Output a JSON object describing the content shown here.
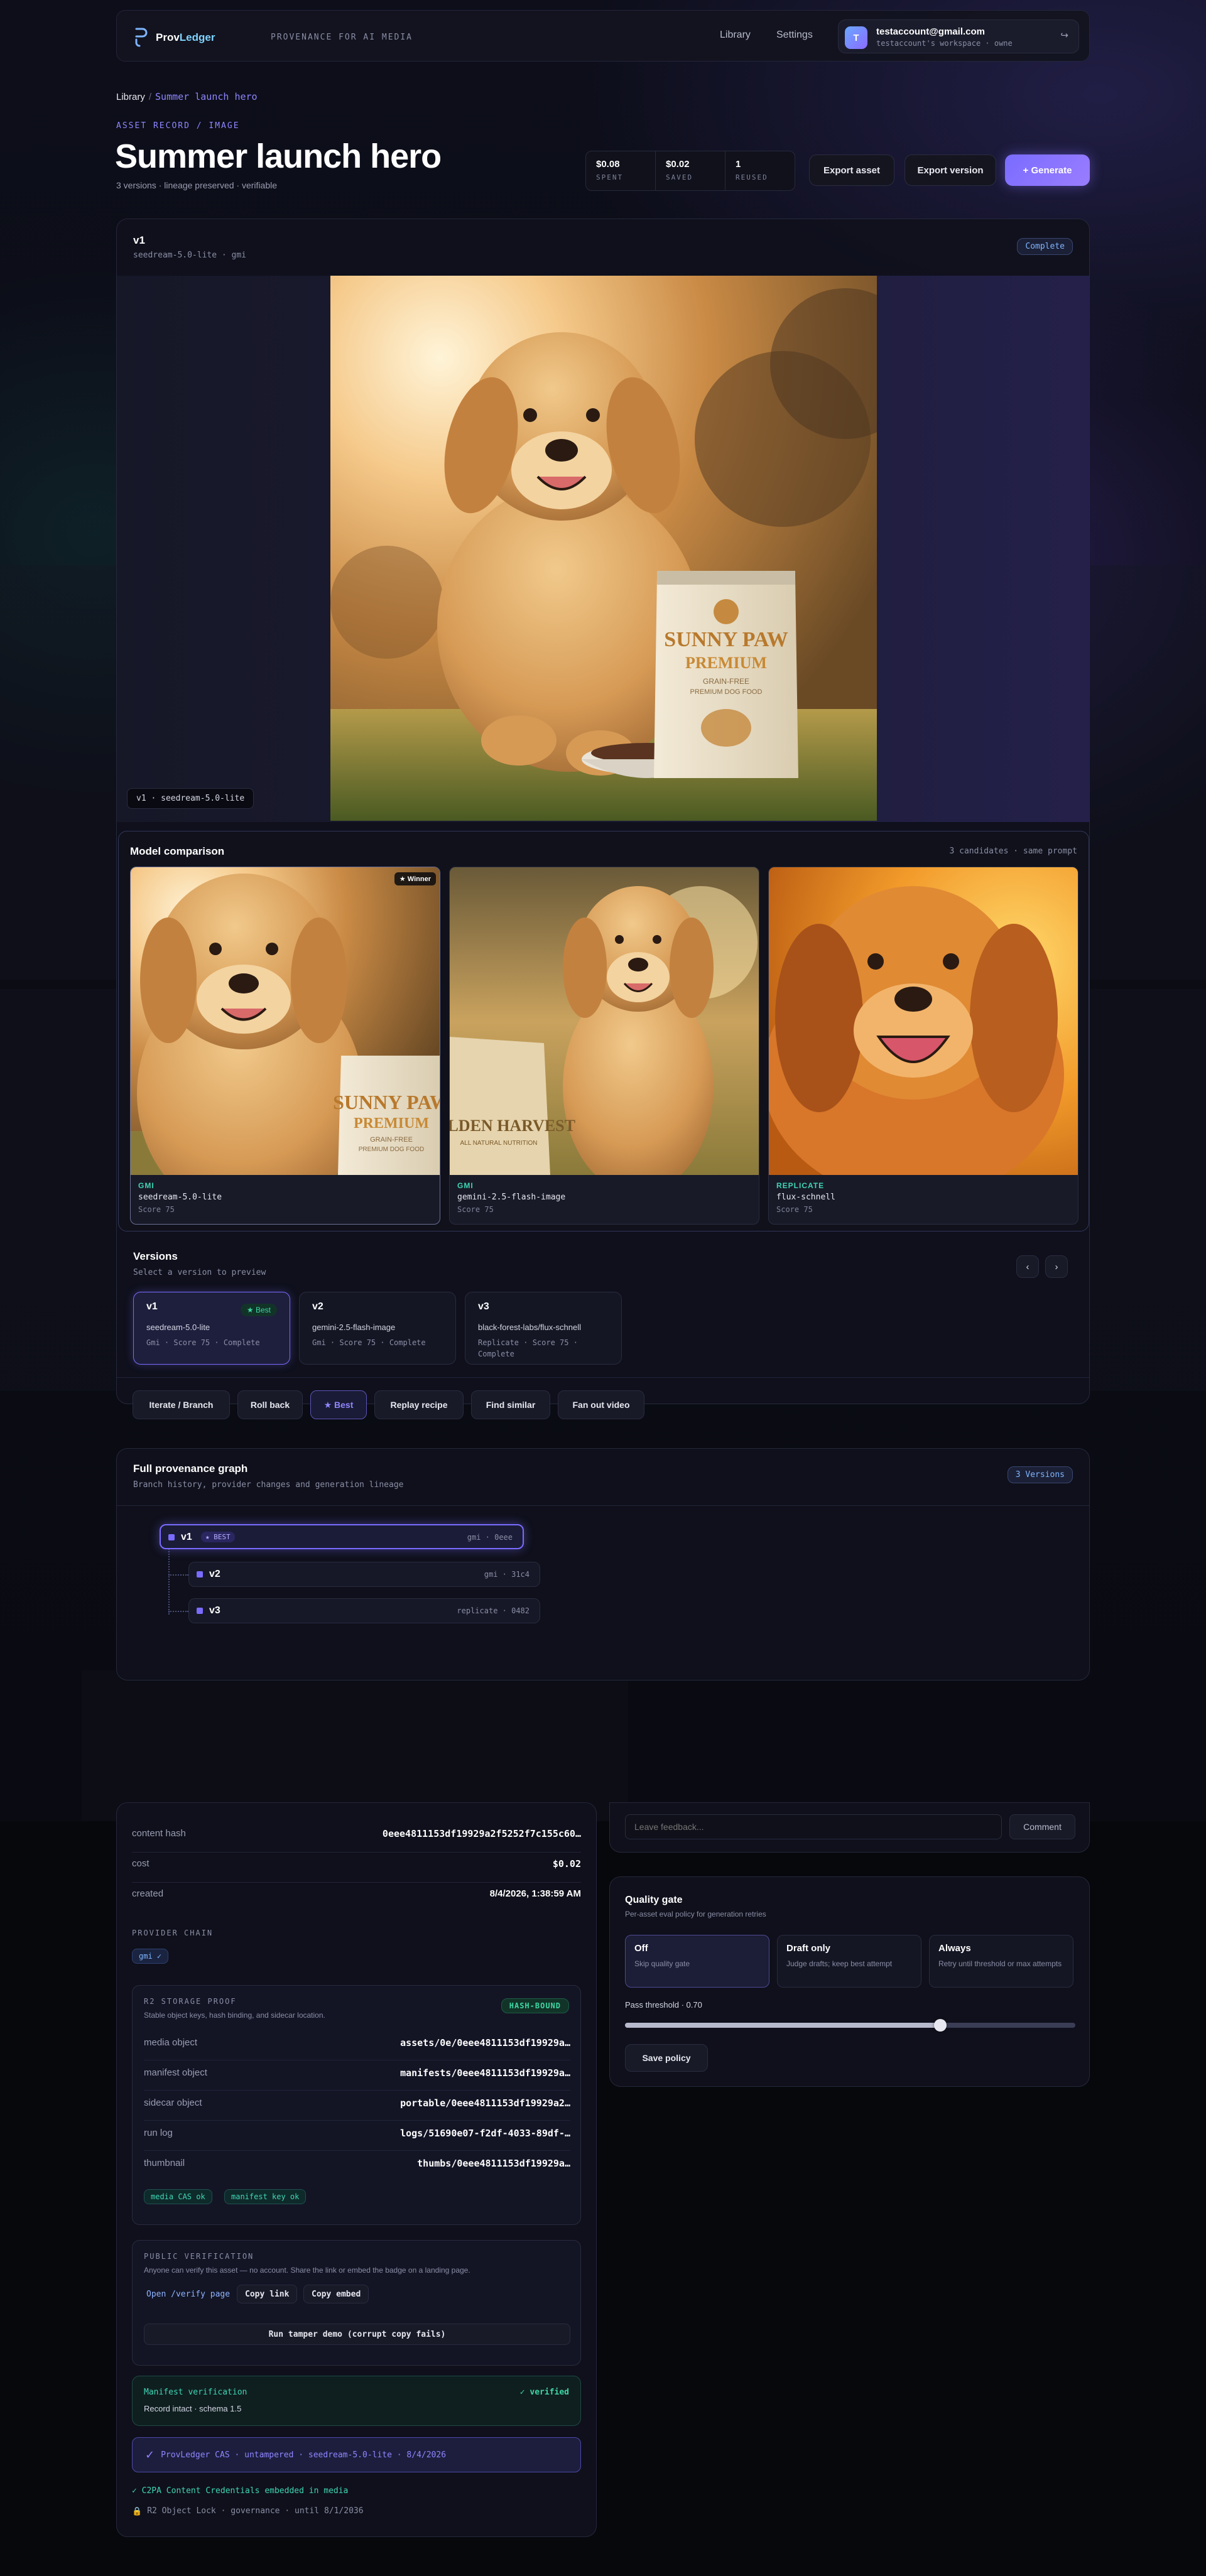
{
  "brand": {
    "name_part1": "Prov",
    "name_part2": "Ledger",
    "tagline": "PROVENANCE FOR AI MEDIA"
  },
  "nav": {
    "library": "Library",
    "settings": "Settings"
  },
  "account": {
    "initial": "T",
    "email": "testaccount@gmail.com",
    "workspace": "testaccount's workspace · owne",
    "logout_icon": "logout-icon"
  },
  "breadcrumb": {
    "root": "Library",
    "separator": "/",
    "current": "Summer launch hero"
  },
  "header": {
    "eyebrow": "ASSET RECORD / IMAGE",
    "title": "Summer launch hero",
    "subtitle": "3 versions · lineage preserved · verifiable"
  },
  "stats": [
    {
      "value": "$0.08",
      "label": "SPENT"
    },
    {
      "value": "$0.02",
      "label": "SAVED"
    },
    {
      "value": "1",
      "label": "REUSED"
    }
  ],
  "actions": {
    "export_asset": "Export asset",
    "export_version": "Export version",
    "generate": "+ Generate"
  },
  "current_version": {
    "name": "v1",
    "model": "seedream-5.0-lite · gmi",
    "status": "Complete",
    "caption": "v1 · seedream-5.0-lite"
  },
  "comparison": {
    "title": "Model comparison",
    "meta": "3 candidates · same prompt",
    "winner_label": "★ Winner",
    "candidates": [
      {
        "provider": "GMI",
        "model": "seedream-5.0-lite",
        "score": "Score 75",
        "bag_line1": "SUNNY PAW",
        "bag_line2": "PREMIUM",
        "bag_line3": "GRAIN-FREE",
        "bag_line4": "PREMIUM DOG FOOD"
      },
      {
        "provider": "GMI",
        "model": "gemini-2.5-flash-image",
        "score": "Score 75",
        "bag_line1": "GOLDEN HARVEST",
        "bag_line2": "ALL NATURAL NUTRITION"
      },
      {
        "provider": "REPLICATE",
        "model": "flux-schnell",
        "score": "Score 75"
      }
    ]
  },
  "hero_bag": {
    "line1": "SUNNY PAW",
    "line2": "PREMIUM",
    "line3": "GRAIN-FREE",
    "line4": "PREMIUM DOG FOOD"
  },
  "versions": {
    "title": "Versions",
    "subtitle": "Select a version to preview",
    "prev": "‹",
    "next": "›",
    "items": [
      {
        "name": "v1",
        "badge": "★ Best",
        "model": "seedream-5.0-lite",
        "meta": "Gmi · Score 75 · Complete"
      },
      {
        "name": "v2",
        "model": "gemini-2.5-flash-image",
        "meta": "Gmi · Score 75 · Complete"
      },
      {
        "name": "v3",
        "model": "black-forest-labs/flux-schnell",
        "meta": "Replicate · Score 75 · Complete"
      }
    ]
  },
  "version_actions": [
    "Iterate / Branch",
    "Roll back",
    "★ Best",
    "Replay recipe",
    "Find similar",
    "Fan out video"
  ],
  "provenance": {
    "title": "Full provenance graph",
    "subtitle": "Branch history, provider changes and generation lineage",
    "badge": "3 Versions",
    "nodes": [
      {
        "name": "v1",
        "best": "★ BEST",
        "meta": "gmi · 0eee"
      },
      {
        "name": "v2",
        "meta": "gmi · 31c4"
      },
      {
        "name": "v3",
        "meta": "replicate · 0482"
      }
    ]
  },
  "details": {
    "rows": [
      {
        "key": "content hash",
        "value": "0eee4811153df19929a2f5252f7c155c60…"
      },
      {
        "key": "cost",
        "value": "$0.02"
      },
      {
        "key": "created",
        "value": "8/4/2026, 1:38:59 AM"
      }
    ],
    "provider_chain_label": "PROVIDER CHAIN",
    "provider_chain_chip": "gmi ✓"
  },
  "storage_proof": {
    "title": "R2 STORAGE PROOF",
    "subtitle": "Stable object keys, hash binding, and sidecar location.",
    "badge": "HASH-BOUND",
    "rows": [
      {
        "key": "media object",
        "value": "assets/0e/0eee4811153df19929a…"
      },
      {
        "key": "manifest object",
        "value": "manifests/0eee4811153df19929a…"
      },
      {
        "key": "sidecar object",
        "value": "portable/0eee4811153df19929a2…"
      },
      {
        "key": "run log",
        "value": "logs/51690e07-f2df-4033-89df-…"
      },
      {
        "key": "thumbnail",
        "value": "thumbs/0eee4811153df19929a…"
      }
    ],
    "chips": [
      "media CAS ok",
      "manifest key ok"
    ]
  },
  "public_verification": {
    "title": "PUBLIC VERIFICATION",
    "subtitle": "Anyone can verify this asset — no account. Share the link or embed the badge on a landing page.",
    "open_link": "Open /verify page",
    "copy_link": "Copy link",
    "copy_embed": "Copy embed",
    "tamper": "Run tamper demo (corrupt copy fails)"
  },
  "manifest": {
    "title": "Manifest verification",
    "status": "✓ verified",
    "detail": "Record intact · schema 1.5"
  },
  "cas": {
    "icon": "✓",
    "text": "ProvLedger CAS · untampered · seedream-5.0-lite · 8/4/2026"
  },
  "c2pa": "✓ C2PA Content Credentials embedded in media",
  "object_lock": {
    "icon": "🔒",
    "text": "R2 Object Lock · governance · until 8/1/2036"
  },
  "comment": {
    "placeholder": "Leave feedback...",
    "button": "Comment"
  },
  "quality_gate": {
    "title": "Quality gate",
    "subtitle": "Per-asset eval policy for generation retries",
    "options": [
      {
        "title": "Off",
        "desc": "Skip quality gate"
      },
      {
        "title": "Draft only",
        "desc": "Judge drafts; keep best attempt"
      },
      {
        "title": "Always",
        "desc": "Retry until threshold or max attempts"
      }
    ],
    "threshold_label": "Pass threshold · 0.70",
    "threshold": 0.7,
    "save": "Save policy"
  },
  "colors": {
    "accent": "#7a6cff",
    "success": "#3fd6a4",
    "info": "#7fb4ff"
  }
}
